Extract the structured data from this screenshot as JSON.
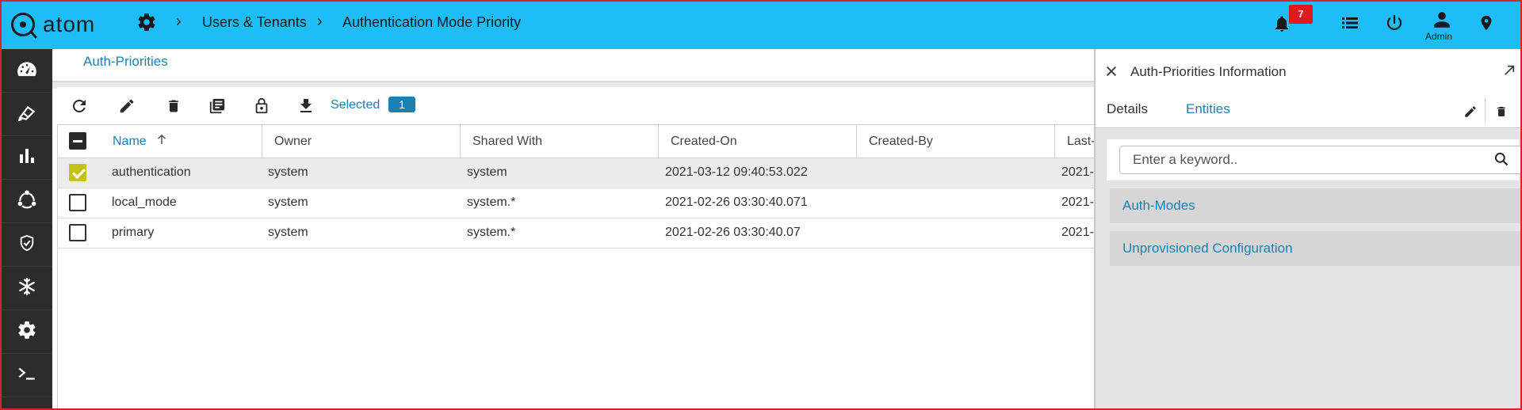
{
  "app": {
    "name": "atom",
    "breadcrumb": [
      "Users & Tenants",
      "Authentication Mode Priority"
    ],
    "notifications_count": "7",
    "user_label": "Admin",
    "accent_color": "#1ebdf8",
    "link_color": "#1f7fb0",
    "icons": {
      "settings": "gear-icon",
      "notifications": "bell-icon",
      "list": "list-icon",
      "power": "power-icon",
      "user": "user-icon",
      "location": "location-pin-icon"
    }
  },
  "sidebar": {
    "items": [
      {
        "icon": "dashboard-icon"
      },
      {
        "icon": "devices-icon"
      },
      {
        "icon": "analytics-icon"
      },
      {
        "icon": "topology-icon"
      },
      {
        "icon": "shield-icon"
      },
      {
        "icon": "snowflake-icon"
      },
      {
        "icon": "settings-icon"
      },
      {
        "icon": "terminal-icon"
      }
    ]
  },
  "page": {
    "title": "Auth-Priorities",
    "toolbar": {
      "selected_label": "Selected",
      "selected_count": "1",
      "icons": [
        "refresh-icon",
        "edit-icon",
        "delete-icon",
        "copy-icon",
        "lock-icon",
        "download-icon"
      ]
    },
    "table": {
      "columns": [
        "Name",
        "Owner",
        "Shared With",
        "Created-On",
        "Created-By",
        "Last-M"
      ],
      "sorted_column": "Name",
      "rows": [
        {
          "checked": true,
          "name": "authentication",
          "owner": "system",
          "shared_with": "system",
          "created_on": "2021-03-12 09:40:53.022",
          "created_by": "",
          "last_modified": "2021-"
        },
        {
          "checked": false,
          "name": "local_mode",
          "owner": "system",
          "shared_with": "system.*",
          "created_on": "2021-02-26 03:30:40.071",
          "created_by": "",
          "last_modified": "2021-"
        },
        {
          "checked": false,
          "name": "primary",
          "owner": "system",
          "shared_with": "system.*",
          "created_on": "2021-02-26 03:30:40.07",
          "created_by": "",
          "last_modified": "2021-"
        }
      ]
    }
  },
  "panel": {
    "title": "Auth-Priorities Information",
    "tabs": [
      "Details",
      "Entities"
    ],
    "active_tab": "Entities",
    "search_placeholder": "Enter a keyword..",
    "entities": [
      "Auth-Modes",
      "Unprovisioned Configuration"
    ]
  }
}
